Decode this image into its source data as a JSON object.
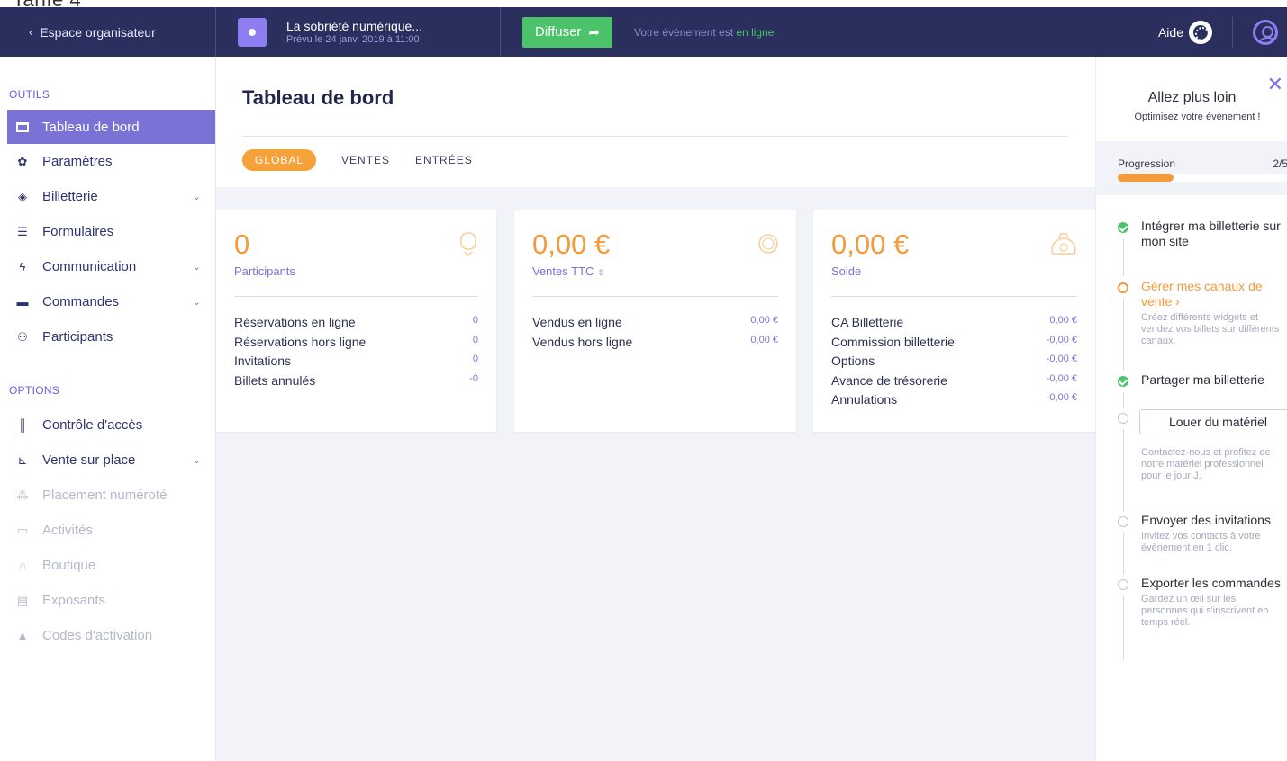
{
  "partial_top_text": "Tarife 4",
  "topbar": {
    "back_label": "Espace organisateur",
    "event_title": "La sobriété numérique...",
    "event_date": "Prévu le 24 janv. 2019 à 11:00",
    "diffuser_label": "Diffuser",
    "status_prefix": "Votre évènement est ",
    "status_online": "en ligne",
    "aide_label": "Aide"
  },
  "sidebar": {
    "outils_label": "OUTILS",
    "options_label": "OPTIONS",
    "outils": [
      {
        "label": "Tableau de bord",
        "icon": "dashboard-icon"
      },
      {
        "label": "Paramètres",
        "icon": "gear-icon"
      },
      {
        "label": "Billetterie",
        "icon": "ticket-icon"
      },
      {
        "label": "Formulaires",
        "icon": "list-icon"
      },
      {
        "label": "Communication",
        "icon": "bolt-icon"
      },
      {
        "label": "Commandes",
        "icon": "credit-card-icon"
      },
      {
        "label": "Participants",
        "icon": "users-icon"
      }
    ],
    "options": [
      {
        "label": "Contrôle d'accès",
        "icon": "barcode-icon"
      },
      {
        "label": "Vente sur place",
        "icon": "cart-icon"
      },
      {
        "label": "Placement numéroté",
        "icon": "sitemap-icon"
      },
      {
        "label": "Activités",
        "icon": "calendar-icon"
      },
      {
        "label": "Boutique",
        "icon": "shop-icon"
      },
      {
        "label": "Exposants",
        "icon": "id-card-icon"
      },
      {
        "label": "Codes d'activation",
        "icon": "lock-icon"
      }
    ]
  },
  "main": {
    "title": "Tableau de bord",
    "tabs": [
      "GLOBAL",
      "VENTES",
      "ENTRÉES"
    ],
    "cards": [
      {
        "big": "0",
        "sub": "Participants",
        "rows": [
          {
            "label": "Réservations en ligne",
            "value": "0"
          },
          {
            "label": "Réservations hors ligne",
            "value": "0"
          },
          {
            "label": "Invitations",
            "value": "0"
          },
          {
            "label": "Billets annulés",
            "value": "-0"
          }
        ]
      },
      {
        "big": "0,00 €",
        "sub": "Ventes TTC",
        "rows": [
          {
            "label": "Vendus en ligne",
            "value": "0,00 €"
          },
          {
            "label": "Vendus hors ligne",
            "value": "0,00 €"
          }
        ]
      },
      {
        "big": "0,00 €",
        "sub": "Solde",
        "rows": [
          {
            "label": "CA Billetterie",
            "value": "0,00 €"
          },
          {
            "label": "Commission billetterie",
            "value": "-0,00 €"
          },
          {
            "label": "Options",
            "value": "-0,00 €"
          },
          {
            "label": "Avance de trésorerie",
            "value": "-0,00 €"
          },
          {
            "label": "Annulations",
            "value": "-0,00 €"
          }
        ]
      }
    ]
  },
  "right_panel": {
    "title": "Allez plus loin",
    "subtitle": "Optimisez votre évènement !",
    "progress_label": "Progression",
    "progress_count": "2/5",
    "progress_fraction": 0.33,
    "steps": [
      {
        "title": "Intégrer ma billetterie sur mon site",
        "desc": "",
        "state": "done"
      },
      {
        "title": "Gérer mes canaux de vente ›",
        "desc": "Créez différents widgets et vendez vos billets sur différents canaux.",
        "state": "current"
      },
      {
        "title": "Partager ma billetterie",
        "desc": "",
        "state": "done"
      },
      {
        "title": "",
        "button": "Louer du matériel",
        "desc": "Contactez-nous et profitez de notre matériel professionnel pour le jour J.",
        "state": "todo"
      },
      {
        "title": "Envoyer des invitations",
        "desc": "Invitez vos contacts à votre évènement en 1 clic.",
        "state": "todo"
      },
      {
        "title": "Exporter les commandes",
        "desc": "Gardez un œil sur les personnes qui s'inscrivent en temps réel.",
        "state": "todo"
      }
    ]
  },
  "colors": {
    "topbar": "#2a2f5e",
    "accent_purple": "#7b72d6",
    "accent_orange": "#f39a3b",
    "green": "#4cc26b"
  }
}
